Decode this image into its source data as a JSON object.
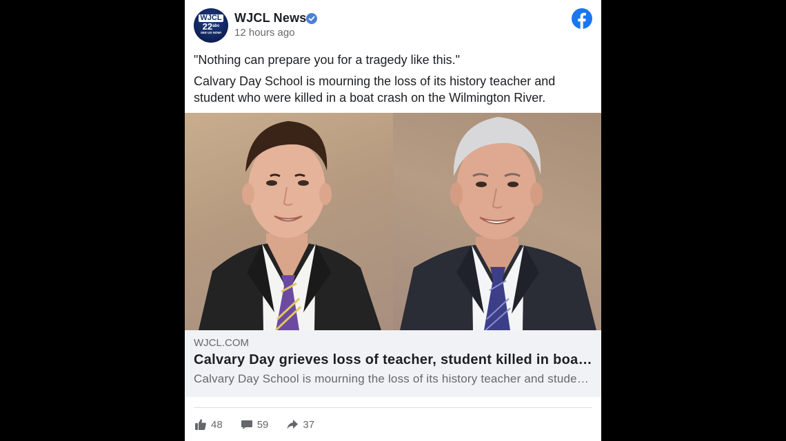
{
  "post": {
    "page_name": "WJCL News",
    "timestamp": "12 hours ago",
    "avatar": {
      "top": "WJCL",
      "num": "22",
      "num_sup": "abc",
      "sub": "SEE US NOW!"
    },
    "quote": "\"Nothing can prepare you for a tragedy like this.\"",
    "body": "Calvary Day School is mourning the loss of its history teacher and student who were killed in a boat crash on the Wilmington River."
  },
  "link_preview": {
    "domain": "WJCL.COM",
    "title": "Calvary Day grieves loss of teacher, student killed in boat crash",
    "description": "Calvary Day School is mourning the loss of its history teacher and student who were killed in a boat crash on the Wilmington River."
  },
  "actions": {
    "likes": "48",
    "comments": "59",
    "shares": "37"
  },
  "icons": {
    "brand": "facebook-icon",
    "verified": "verified-badge-icon",
    "like": "thumbs-up-icon",
    "comment": "comment-bubble-icon",
    "share": "share-arrow-icon"
  },
  "colors": {
    "facebook_blue": "#1877f2",
    "verified_blue": "#4b7fd6",
    "secondary_text": "#65676b",
    "link_preview_bg": "#f0f2f5"
  }
}
